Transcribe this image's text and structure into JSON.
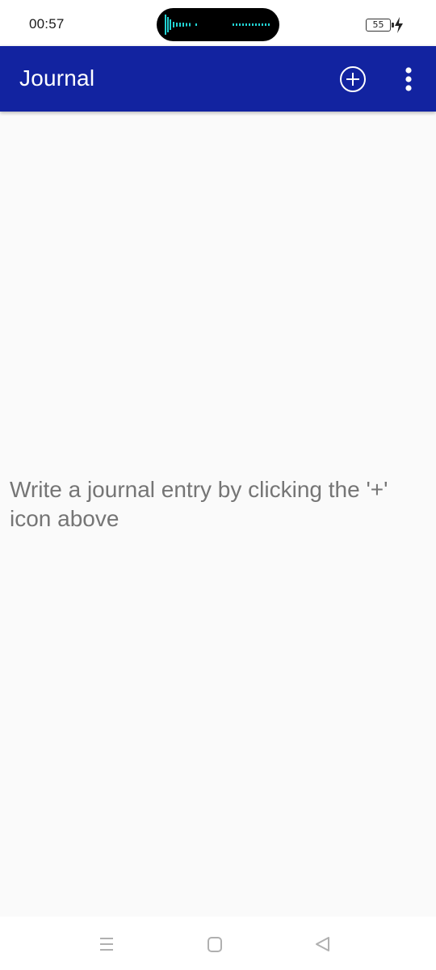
{
  "status_bar": {
    "time": "00:57",
    "battery_level": "55"
  },
  "app_bar": {
    "title": "Journal",
    "background_color": "#1223a0",
    "add_icon": "add-circle-icon",
    "menu_icon": "more-vertical-icon"
  },
  "main": {
    "empty_message": "Write a journal entry by clicking the '+' icon above"
  },
  "nav_bar": {
    "recents_icon": "menu-lines-icon",
    "home_icon": "square-home-icon",
    "back_icon": "triangle-back-icon"
  }
}
